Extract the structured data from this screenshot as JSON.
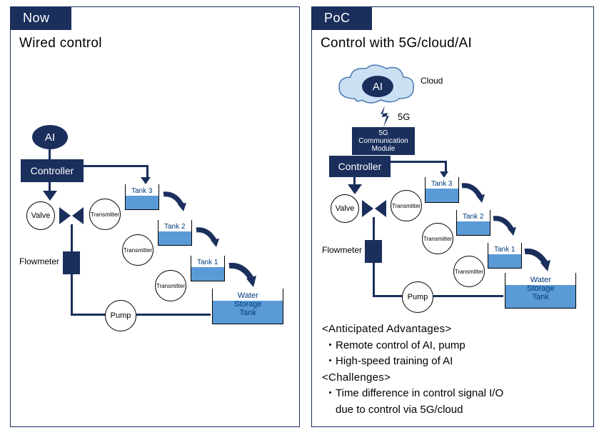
{
  "left": {
    "tab": "Now",
    "title": "Wired control",
    "ai": "AI",
    "controller": "Controller",
    "valve": "Valve",
    "flowmeter": "Flowmeter",
    "pump": "Pump",
    "tanks": [
      "Tank 3",
      "Tank 2",
      "Tank 1"
    ],
    "transmitter": "Transmitter",
    "storage_l1": "Water",
    "storage_l2": "Storage",
    "storage_l3": "Tank"
  },
  "right": {
    "tab": "PoC",
    "title": "Control with 5G/cloud/AI",
    "ai": "AI",
    "cloud_label": "Cloud",
    "fiveg_label": "5G",
    "module_l1": "5G",
    "module_l2": "Communication",
    "module_l3": "Module",
    "controller": "Controller",
    "valve": "Valve",
    "flowmeter": "Flowmeter",
    "pump": "Pump",
    "tanks": [
      "Tank 3",
      "Tank 2",
      "Tank 1"
    ],
    "transmitter": "Transmitter",
    "storage_l1": "Water",
    "storage_l2": "Storage",
    "storage_l3": "Tank",
    "adv_header": "<Anticipated Advantages>",
    "adv_items": [
      "・Remote control of AI, pump",
      "・High-speed training of AI"
    ],
    "chal_header": "<Challenges>",
    "chal_items": [
      "・Time difference in control signal I/O",
      "　due to control via 5G/cloud"
    ]
  }
}
